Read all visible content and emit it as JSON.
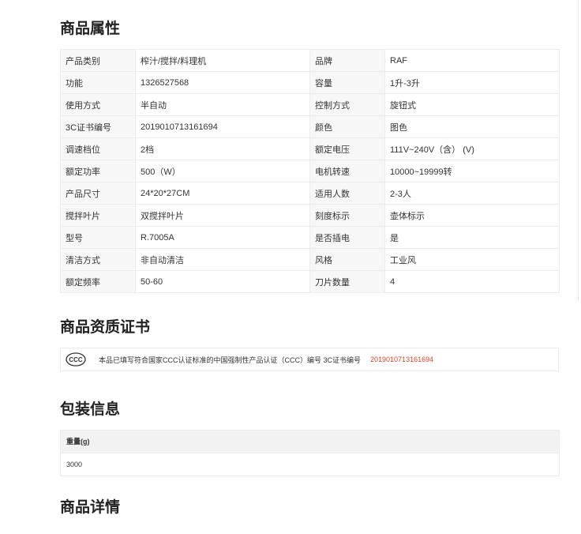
{
  "attributes": {
    "title": "商品属性",
    "rows": [
      {
        "k1": "产品类别",
        "v1": "榨汁/搅拌/料理机",
        "k2": "品牌",
        "v2": "RAF"
      },
      {
        "k1": "功能",
        "v1": "1326527568",
        "k2": "容量",
        "v2": "1升-3升"
      },
      {
        "k1": "使用方式",
        "v1": "半自动",
        "k2": "控制方式",
        "v2": "旋钮式"
      },
      {
        "k1": "3C证书编号",
        "v1": "2019010713161694",
        "k2": "颜色",
        "v2": "图色"
      },
      {
        "k1": "调速档位",
        "v1": "2档",
        "k2": "额定电压",
        "v2": "111V~240V（含） (V)"
      },
      {
        "k1": "额定功率",
        "v1": "500（W）",
        "k2": "电机转速",
        "v2": "10000~19999转"
      },
      {
        "k1": "产品尺寸",
        "v1": "24*20*27CM",
        "k2": "适用人数",
        "v2": "2-3人"
      },
      {
        "k1": "搅拌叶片",
        "v1": "双搅拌叶片",
        "k2": "刻度标示",
        "v2": "壶体标示"
      },
      {
        "k1": "型号",
        "v1": "R.7005A",
        "k2": "是否插电",
        "v2": "是"
      },
      {
        "k1": "清洁方式",
        "v1": "非自动清洁",
        "k2": "风格",
        "v2": "工业风"
      },
      {
        "k1": "额定频率",
        "v1": "50-60",
        "k2": "刀片数量",
        "v2": "4"
      }
    ]
  },
  "certificate": {
    "title": "商品资质证书",
    "icon": "ccc-certification-icon",
    "text": "本品已填写符合国家CCC认证标准的中国强制性产品认证（CCC）编号 3C证书编号",
    "number": "2019010713161694",
    "number_color": "#e0452b"
  },
  "packaging": {
    "title": "包装信息",
    "header": "重量(g)",
    "value": "3000"
  },
  "details": {
    "title": "商品详情"
  }
}
